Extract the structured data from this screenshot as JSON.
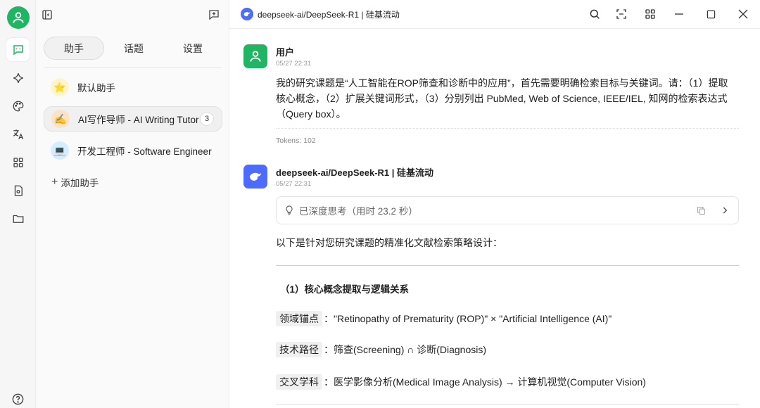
{
  "rail": {
    "items": [
      "chat-icon",
      "sparkle-icon",
      "palette-icon",
      "translate-icon",
      "apps-icon",
      "file-icon",
      "folder-icon",
      "help-icon"
    ]
  },
  "sidebar": {
    "tabs": [
      {
        "label": "助手",
        "active": true
      },
      {
        "label": "话题",
        "active": false
      },
      {
        "label": "设置",
        "active": false
      }
    ],
    "assistants": [
      {
        "name": "默认助手",
        "emoji": "⭐",
        "bg": "#fff4cc"
      },
      {
        "name": "AI写作导师 - AI Writing Tutor",
        "emoji": "✍️",
        "bg": "#ffe2c4",
        "badge": "3",
        "active": true
      },
      {
        "name": "开发工程师 - Software Engineer",
        "emoji": "💻",
        "bg": "#d6ecff"
      }
    ],
    "add_label": "添加助手"
  },
  "header": {
    "title": "deepseek-ai/DeepSeek-R1 | 硅基流动"
  },
  "chat": {
    "user": {
      "name": "用户",
      "time": "05/27 22:31",
      "lines": [
        "我的研究课题是“人工智能在ROP筛查和诊断中的应用”，首先需要明确检索目标与关键词。请：（1）提取",
        "核心概念，（2）扩展关键词形式，（3）分别列出 PubMed, Web of Science, IEEE/IEL, 知网的检索表达式",
        "（Query box）。"
      ],
      "tokens": "Tokens: 102"
    },
    "assistant": {
      "name": "deepseek-ai/DeepSeek-R1 | 硅基流动",
      "time": "05/27 22:31",
      "think": "已深度思考（用时 23.2 秒）",
      "intro": "以下是针对您研究课题的精准化文献检索策略设计：",
      "section_title": "（1）核心概念提取与逻辑关系",
      "rows": [
        {
          "key": "领域锚点",
          "sep": "：",
          "value": "\"Retinopathy of Prematurity (ROP)\" × \"Artificial Intelligence (AI)\""
        },
        {
          "key": "技术路径",
          "sep": "：",
          "value": "筛查(Screening) ∩ 诊断(Diagnosis)"
        },
        {
          "key": "交叉学科",
          "sep": "：",
          "value": "医学影像分析(Medical Image Analysis) → 计算机视觉(Computer Vision)"
        }
      ]
    }
  },
  "colors": {
    "brand_green": "#1fb562",
    "deepseek_blue": "#4d6bfe"
  }
}
